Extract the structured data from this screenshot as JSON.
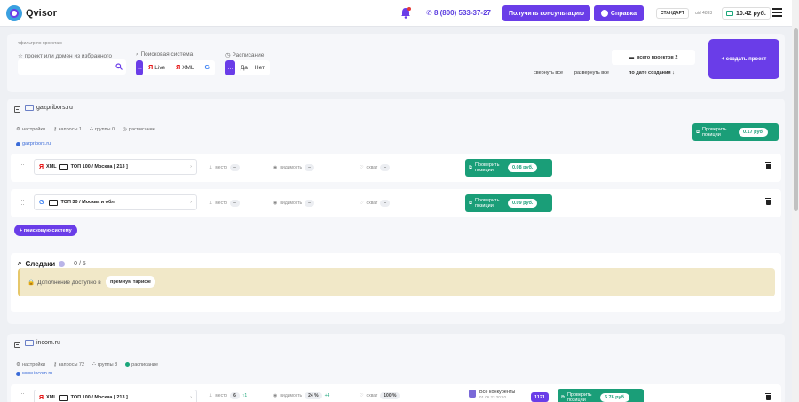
{
  "header": {
    "logo_text": "Qvisor",
    "phone": "8 (800) 533-37-27",
    "consult_label": "Получить консультацию",
    "help_label": "Справка",
    "tariff": "СТАНДАРТ",
    "uid": "uid 4893",
    "balance": "10.42 руб."
  },
  "filters": {
    "title": "фильтр по проектам",
    "project_search_placeholder": "проект или домен из избранного",
    "search_engine_label": "Поисковая система",
    "engine_options": [
      "...",
      "Live",
      "XML",
      "G"
    ],
    "schedule_label": "Расписание",
    "schedule_options": [
      "...",
      "Да",
      "Нет"
    ],
    "collapse_all": "свернуть все",
    "expand_all": "развернуть все",
    "all_projects": "всего проектов 2",
    "sort_label": "по дате создания ↓",
    "create_project": "+ создать проект"
  },
  "projects": [
    {
      "domain": "gazpribors.ru",
      "settings": "настройки",
      "queries": "запросы 1",
      "groups": "группы 0",
      "schedule": "расписание",
      "link": "gazpribors.ru",
      "check_label": "Проверить позиции",
      "check_price": "0.17 руб.",
      "engines": [
        {
          "name": "XML",
          "region": "ТОП 100 / Москва [ 213 ]",
          "place_label": "место",
          "place": "–",
          "visibility_label": "видимость",
          "visibility": "–",
          "clicks_label": "охват",
          "clicks": "–",
          "check_label": "Проверить позиции",
          "check_price": "0.08 руб."
        },
        {
          "name": "",
          "region": "ТОП 30 / Москва и обл",
          "place_label": "место",
          "place": "–",
          "visibility_label": "видимость",
          "visibility": "–",
          "clicks_label": "охват",
          "clicks": "–",
          "check_label": "Проверить позиции",
          "check_price": "0.09 руб."
        }
      ],
      "add_engine": "+ поисковую систему",
      "tracking_title": "Следаки",
      "tracking_count": "0 / 5",
      "premium_text": "Дополнение доступно в",
      "premium_pill": "премиум тарифе"
    },
    {
      "domain": "incom.ru",
      "settings": "настройки",
      "queries": "запросы 72",
      "groups": "группы 8",
      "schedule": "расписание",
      "link": "www.incom.ru",
      "engines": [
        {
          "name": "XML",
          "region": "ТОП 100 / Москва [ 213 ]",
          "place_label": "место",
          "place": "6",
          "place_delta": "↑1",
          "visibility_label": "видимость",
          "visibility": "24 %",
          "visibility_delta": "+4",
          "clicks_label": "охват",
          "clicks": "100 %",
          "competitors": "Все конкуренты",
          "competitors_sub": "01.06.23 20:10",
          "count": "1121",
          "check_label": "Проверить позиции",
          "check_price": "5.76 руб."
        }
      ]
    }
  ]
}
